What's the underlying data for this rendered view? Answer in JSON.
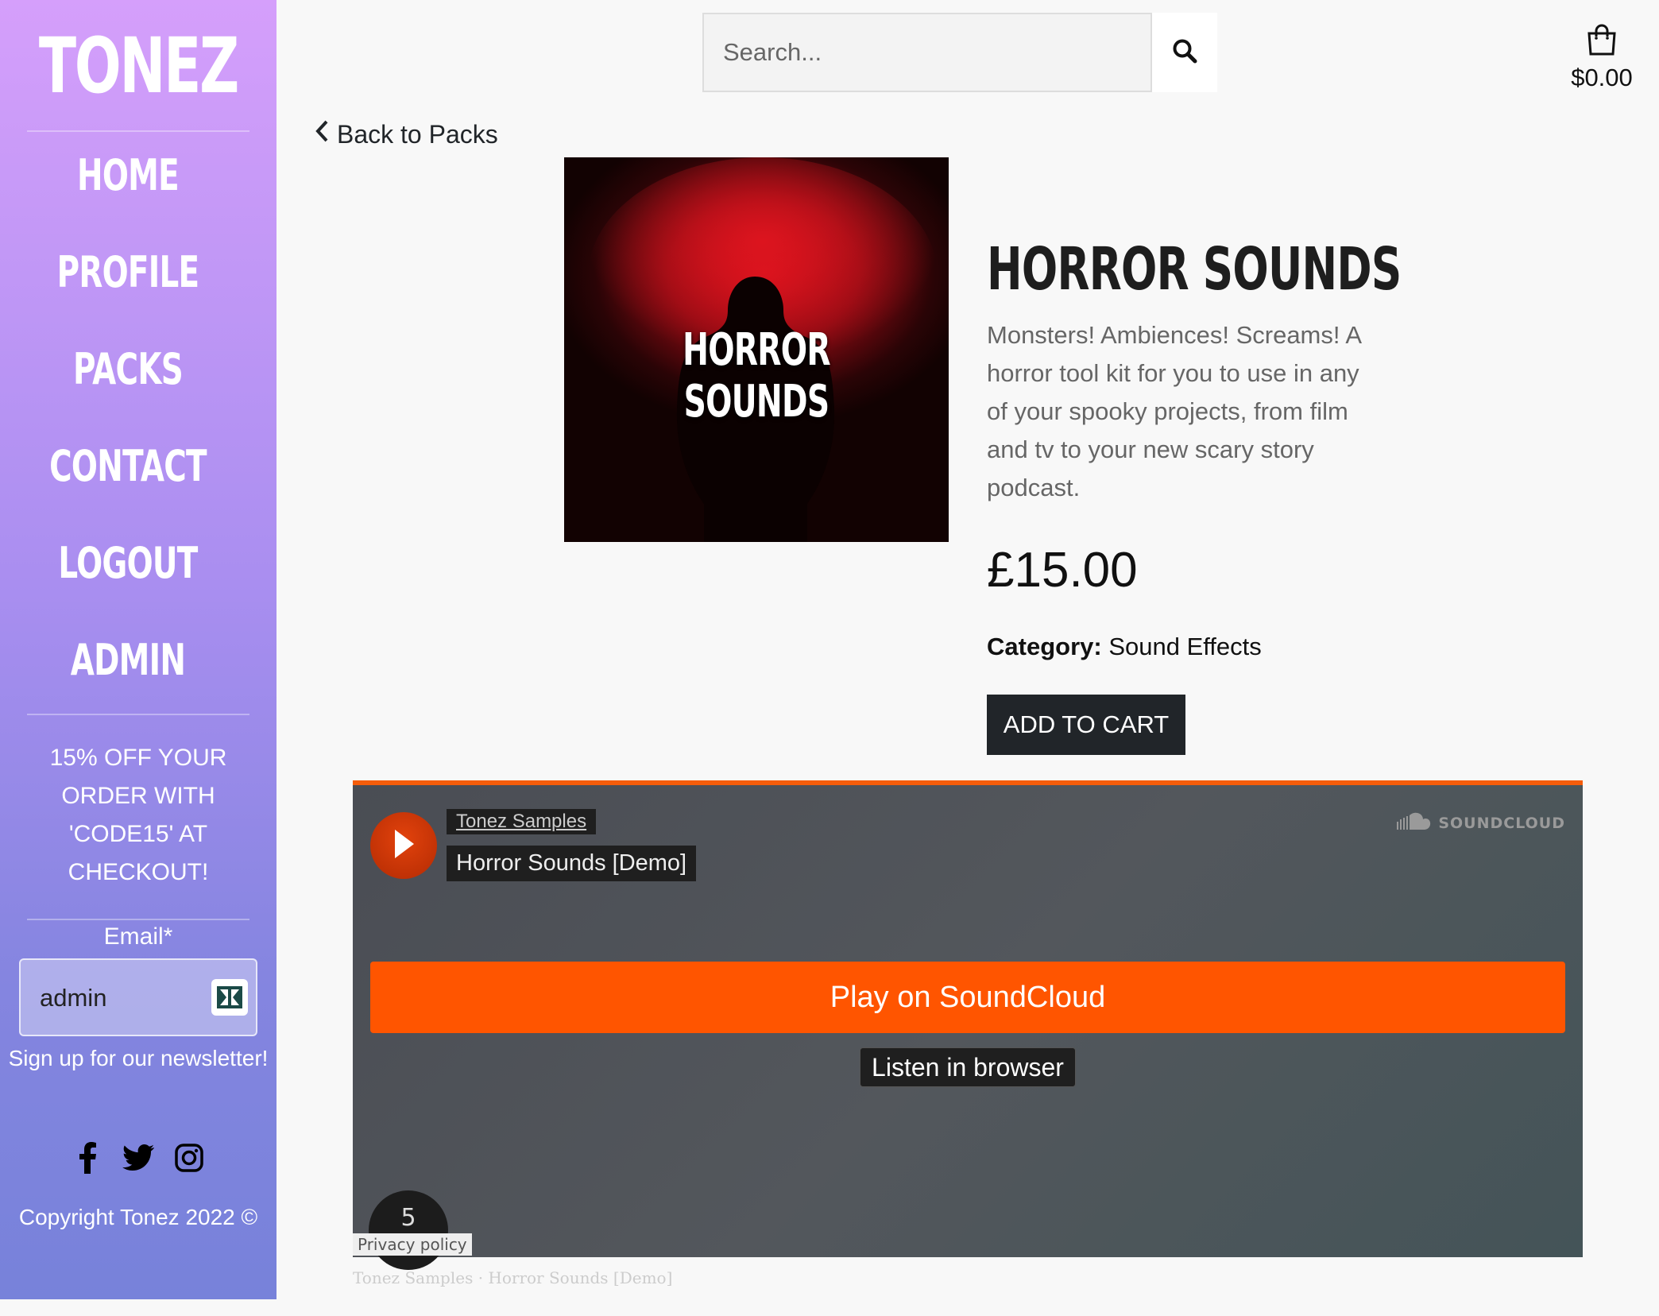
{
  "sidebar": {
    "brand": "TONEZ",
    "nav": [
      {
        "label": "HOME"
      },
      {
        "label": "PROFILE"
      },
      {
        "label": "PACKS"
      },
      {
        "label": "CONTACT"
      },
      {
        "label": "LOGOUT"
      },
      {
        "label": "ADMIN"
      }
    ],
    "promo": "15% OFF YOUR ORDER WITH 'CODE15' AT CHECKOUT!",
    "email_label": "Email*",
    "email_value": "admin",
    "signup_text": "Sign up for our newsletter!",
    "social": [
      "facebook-icon",
      "twitter-icon",
      "instagram-icon"
    ],
    "copyright": "Copyright Tonez 2022 ©"
  },
  "header": {
    "search_placeholder": "Search...",
    "cart_total": "$0.00"
  },
  "product": {
    "back_label": "Back to Packs",
    "cover_text": "HORROR SOUNDS",
    "title": "HORROR SOUNDS",
    "description": "Monsters! Ambiences! Screams! A horror tool kit for you to use in any of your spooky projects, from film and tv to your new scary story podcast.",
    "price": "£15.00",
    "category_label": "Category:",
    "category_value": "Sound Effects",
    "add_to_cart": "ADD TO CART"
  },
  "soundcloud": {
    "artist": "Tonez Samples",
    "track": "Horror Sounds [Demo]",
    "logo": "SOUNDCLOUD",
    "play_button": "Play on SoundCloud",
    "listen_button": "Listen in browser",
    "count": "5",
    "privacy": "Privacy policy",
    "footer_artist": "Tonez Samples",
    "footer_sep": "·",
    "footer_track": "Horror Sounds [Demo]",
    "accent": "#ff5500"
  }
}
